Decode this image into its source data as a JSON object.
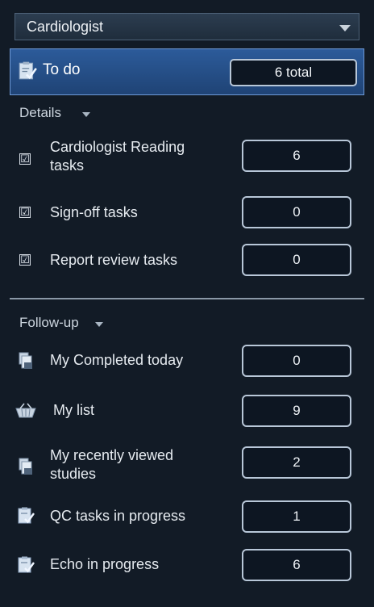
{
  "role_select": {
    "value": "Cardiologist"
  },
  "todo": {
    "icon": "clipboard-check-icon",
    "label": "To do",
    "total": "6 total"
  },
  "details": {
    "label": "Details",
    "items": [
      {
        "line1": "Cardiologist Reading",
        "line2": "tasks",
        "checked": "☑",
        "count": "6"
      },
      {
        "label": "Sign-off tasks",
        "checked": "☑",
        "count": "0"
      },
      {
        "label": "Report review tasks",
        "checked": "☑",
        "count": "0"
      }
    ]
  },
  "followup": {
    "label": "Follow-up",
    "items": [
      {
        "label": "My Completed today",
        "icon": "completed-stack-icon",
        "count": "0"
      },
      {
        "label": "My list",
        "icon": "basket-icon",
        "count": "9"
      },
      {
        "line1": "My recently viewed",
        "line2": "studies",
        "icon": "recent-stack-icon",
        "count": "2"
      },
      {
        "label": "QC tasks in progress",
        "icon": "clipboard-check-icon",
        "count": "1"
      },
      {
        "label": "Echo in progress",
        "icon": "clipboard-check-icon",
        "count": "6"
      }
    ]
  }
}
